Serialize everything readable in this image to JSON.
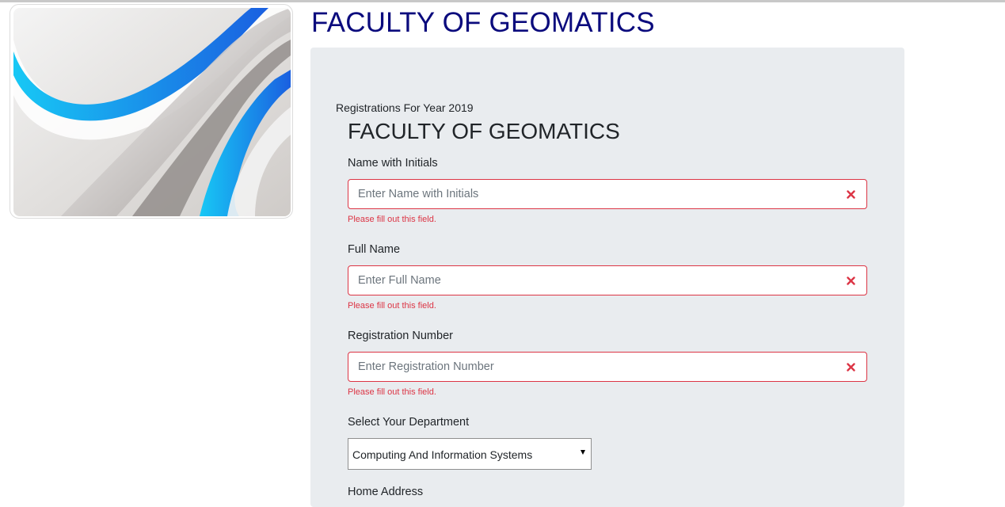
{
  "header": {
    "title": "FACULTY OF GEOMATICS"
  },
  "form": {
    "registration_year_text": "Registrations For Year 2019",
    "heading": "FACULTY OF GEOMATICS",
    "fields": [
      {
        "label": "Name with Initials",
        "placeholder": "Enter Name with Initials",
        "value": "",
        "error": "Please fill out this field.",
        "icon": "clear-x-icon"
      },
      {
        "label": "Full Name",
        "placeholder": "Enter Full Name",
        "value": "",
        "error": "Please fill out this field.",
        "icon": "clear-x-icon"
      },
      {
        "label": "Registration Number",
        "placeholder": "Enter Registration Number",
        "value": "",
        "error": "Please fill out this field.",
        "icon": "clear-x-icon"
      }
    ],
    "department": {
      "label": "Select Your Department",
      "selected": "Computing And Information Systems",
      "icon": "caret-down-icon"
    },
    "home_address": {
      "label": "Home Address"
    }
  },
  "colors": {
    "title": "#0b0b7d",
    "panel": "#e9ecef",
    "error": "#dc3545",
    "accent_blue": "#1e9bff"
  }
}
